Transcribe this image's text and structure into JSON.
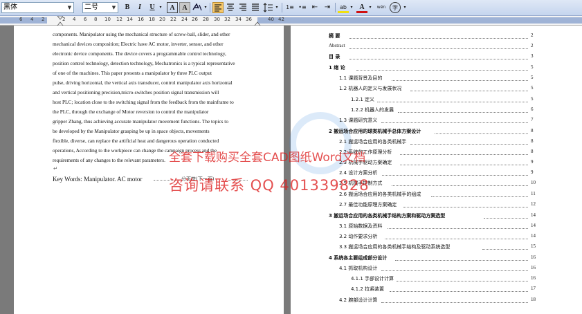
{
  "toolbar": {
    "font_name": "黑体",
    "font_size": "二号",
    "bold": "B",
    "italic": "I",
    "underline": "U",
    "char_border": "A",
    "char_shade": "A",
    "numbering": "1≡",
    "bullets": "•≡",
    "indent_dec": "⇤",
    "indent_inc": "⇥",
    "highlight": "ab",
    "font_color": "A",
    "phonetic": "wén",
    "enclose": "字"
  },
  "ruler": {
    "left_numbers": [
      "6",
      "4",
      "2"
    ],
    "numbers": [
      "2",
      "4",
      "6",
      "8",
      "10",
      "12",
      "14",
      "16",
      "18",
      "20",
      "22",
      "24",
      "26",
      "28",
      "30",
      "32",
      "34",
      "36"
    ],
    "right_numbers": [
      "40",
      "42"
    ]
  },
  "left_page": {
    "lines": [
      "components. Manipulator  using     the mechanical structure    of screw-ball, slider,    and other",
      "mechanical devices composition;   Electric   have AC motor, inverter, sensor, and other",
      "electronic device components.  The device   covers   a programmable control  technology,",
      "position control technology, detection technology, Mechatronics is a typical   representative",
      "of one of the  machines.  This paper presents   a  manipulator by   three PLC  output",
      "pulse,    driving horizontal, the vertical axis transducer, control manipulator axis   horizontal",
      "and  vertical   positioning  precision,micro-switches  position    signal   transmission  will",
      "host PLC;    location close to the switching signal from the feedback from the    mainframe to",
      "the   PLC,  through     the   exchange  of    Motor reversion to control the   manipulator",
      "gripper   Zhang, thus achieving accurate manipulator movement functions. The   topics to",
      "be developed by      the   Manipulator grasping   be  up   in   space objects, movements",
      "flexible,    diverse,  can  replace  the  artificial  heat  and  dangerous  operation  conducted",
      "operations, According   to   the  workpiece can change the   campaign process and the",
      "requirements    of any changes to    the relevant parameters."
    ],
    "mark": "↵",
    "keywords": "Key Words:  Manipulator. AC motor",
    "section_break": "分页符(下一页)"
  },
  "toc": [
    {
      "text": "摘    要",
      "page": "2"
    },
    {
      "text": "Abstract",
      "page": "2"
    },
    {
      "text": "目    录",
      "page": "3"
    },
    {
      "text": "1   绪    论",
      "page": "5"
    },
    {
      "text": "1.1  课题背景及目的",
      "page": "5"
    },
    {
      "text": "1.2  机器人的定义与发展状况",
      "page": "5"
    },
    {
      "text": "1.2.1  定义",
      "page": "5"
    },
    {
      "text": "1.2.2  机器人的发展",
      "page": "6"
    },
    {
      "text": "1.3 课题研究意义",
      "page": "7"
    },
    {
      "text": "2  搬运场合应用的球类机械手总体方案设计",
      "page": "8"
    },
    {
      "text": "2.1 搬运场合应用的各类机械手",
      "page": "8"
    },
    {
      "text": "2.2 系统的工作原理分析",
      "page": "8"
    },
    {
      "text": "2.3 机械手驱动方案确定",
      "page": "9"
    },
    {
      "text": "2.4 设计方案分析",
      "page": "9"
    },
    {
      "text": "2.5 机械手控制方式",
      "page": "10"
    },
    {
      "text": "2.6 搬运场合应用的各类机械手的组成",
      "page": "11"
    },
    {
      "text": "2.7 最佳功能原理方案确定",
      "page": "12"
    },
    {
      "text": "3  搬运场合应用的各类机械手结构方案和驱动方案选型",
      "page": "14"
    },
    {
      "text": "3.1 原始数据及资料",
      "page": "14"
    },
    {
      "text": "3.2  动作要求分析",
      "page": "14"
    },
    {
      "text": "3.3 搬运场合应用的各类机械手结构及驱动系统选型",
      "page": "15"
    },
    {
      "text": "4  系统各主要组成部分设计",
      "page": "16"
    },
    {
      "text": "4.1 抓取机构设计",
      "page": "16"
    },
    {
      "text": "4.1.1 手部设计计算",
      "page": "16"
    },
    {
      "text": "4.1.2 拉紧装置",
      "page": "17"
    },
    {
      "text": "4.2 腕部设计计算",
      "page": "18"
    }
  ],
  "watermark": {
    "line1": "全套下载购买全套CAD图纸Word文档",
    "line2": "咨询请联系 QQ 401339828"
  }
}
